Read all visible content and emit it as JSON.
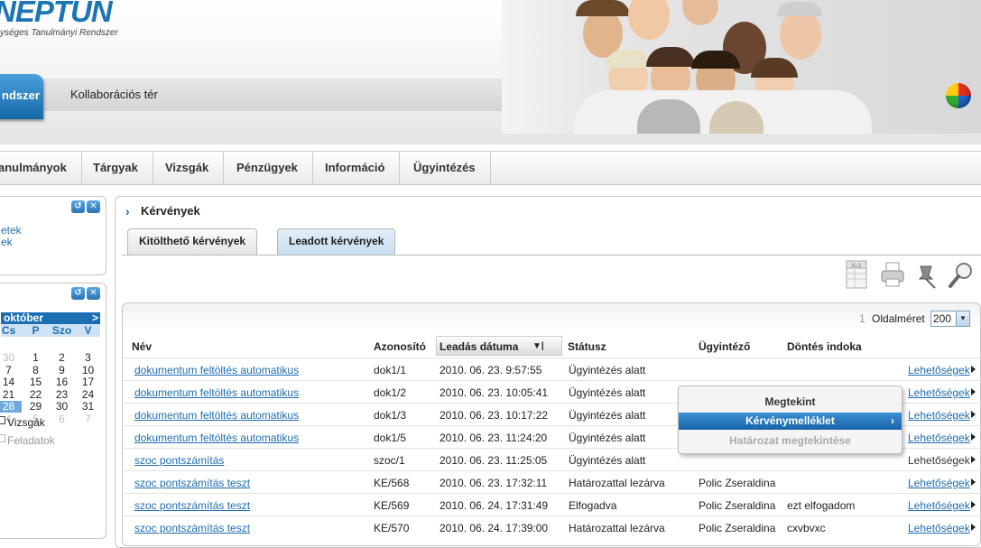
{
  "header": {
    "logo": "NEPTUN",
    "logo_sub": "ységes Tanulmányi Rendszer",
    "rendszer_tab": "ndszer",
    "kollab": "Kollaborációs tér"
  },
  "menu": [
    "anulmányok",
    "Tárgyak",
    "Vizsgák",
    "Pénzügyek",
    "Információ",
    "Ügyintézés"
  ],
  "sidebar": {
    "links": [
      "etek",
      "ek"
    ],
    "calendar": {
      "month": "október",
      "next": ">",
      "day_names": [
        "Cs",
        "P",
        "Szo",
        "V"
      ],
      "weeks": [
        [
          "30",
          "1",
          "2",
          "3"
        ],
        [
          "7",
          "8",
          "9",
          "10"
        ],
        [
          "14",
          "15",
          "16",
          "17"
        ],
        [
          "21",
          "22",
          "23",
          "24"
        ],
        [
          "28",
          "29",
          "30",
          "31"
        ],
        [
          "4",
          "5",
          "6",
          "7"
        ]
      ]
    },
    "filters": [
      "Vizsgák",
      "Feladatok"
    ]
  },
  "content": {
    "title": "Kérvények",
    "tabs": [
      "Kitölthető kérvények",
      "Leadott kérvények"
    ],
    "toolbar_icons": [
      "xls-export-icon",
      "print-icon",
      "pin-icon",
      "search-icon"
    ],
    "pager": {
      "page": "1",
      "label": "Oldalméret",
      "size": "200"
    },
    "columns": [
      "Név",
      "Azonosító",
      "Leadás dátuma",
      "Státusz",
      "Ügyintéző",
      "Döntés indoka"
    ],
    "rows": [
      {
        "name": "dokumentum feltöltés automatikus",
        "id": "dok1/1",
        "date": "2010. 06. 23. 9:57:55",
        "status": "Ügyintézés alatt",
        "handler": "",
        "reason": "",
        "opt": "Lehetőségek"
      },
      {
        "name": "dokumentum feltöltés automatikus",
        "id": "dok1/2",
        "date": "2010. 06. 23. 10:05:41",
        "status": "Ügyintézés alatt",
        "handler": "",
        "reason": "",
        "opt": "Lehetőségek"
      },
      {
        "name": "dokumentum feltöltés automatikus",
        "id": "dok1/3",
        "date": "2010. 06. 23. 10:17:22",
        "status": "Ügyintézés alatt",
        "handler": "",
        "reason": "",
        "opt": "Lehetőségek"
      },
      {
        "name": "dokumentum feltöltés automatikus",
        "id": "dok1/5",
        "date": "2010. 06. 23. 11:24:20",
        "status": "Ügyintézés alatt",
        "handler": "",
        "reason": "",
        "opt": "Lehetőségek"
      },
      {
        "name": "szoc pontszámítás",
        "id": "szoc/1",
        "date": "2010. 06. 23. 11:25:05",
        "status": "Ügyintézés alatt",
        "handler": "",
        "reason": "",
        "opt": "Lehetőségek"
      },
      {
        "name": "szoc pontszámítás teszt",
        "id": "KE/568",
        "date": "2010. 06. 23. 17:32:11",
        "status": "Határozattal lezárva",
        "handler": "Polic Zseraldina",
        "reason": "",
        "opt": "Lehetőségek"
      },
      {
        "name": "szoc pontszámítás teszt",
        "id": "KE/569",
        "date": "2010. 06. 24. 17:31:49",
        "status": "Elfogadva",
        "handler": "Polic Zseraldina",
        "reason": "ezt elfogadom",
        "opt": "Lehetőségek"
      },
      {
        "name": "szoc pontszámítás teszt",
        "id": "KE/570",
        "date": "2010. 06. 24. 17:39:00",
        "status": "Határozattal lezárva",
        "handler": "Polic Zseraldina",
        "reason": "cxvbvxc",
        "opt": "Lehetőségek"
      }
    ],
    "context_menu": [
      "Megtekint",
      "Kérvénymelléklet",
      "Határozat megtekintése"
    ]
  },
  "colors": {
    "accent": "#1d6fb3",
    "link": "#1f6db0",
    "menu_selected": "#1a63a8"
  }
}
